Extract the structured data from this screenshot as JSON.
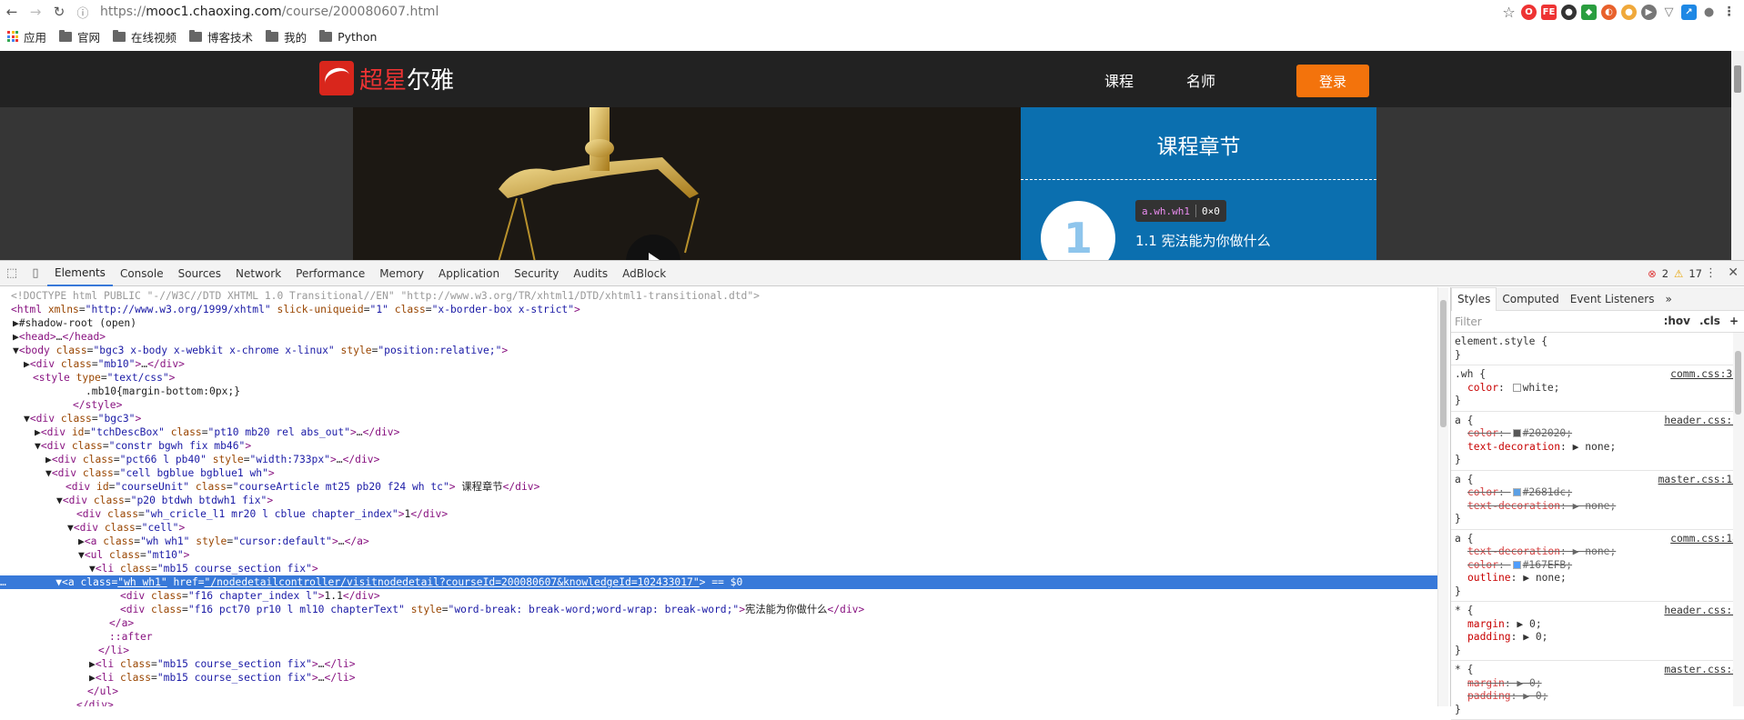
{
  "browser": {
    "url_prefix": "https://",
    "url_host": "mooc1.chaoxing.com",
    "url_path": "/course/200080607.html",
    "bookmarks": [
      "应用",
      "官网",
      "在线视频",
      "博客技术",
      "我的",
      "Python"
    ]
  },
  "site": {
    "logo_text_a": "超星",
    "logo_text_b": "尔雅",
    "nav": [
      "课程",
      "名师"
    ],
    "login": "登录",
    "panel_title": "课程章节",
    "chapter_num": "1",
    "chapter_label": "1.1  宪法能为你做什么",
    "tooltip_tag": "a.wh.wh1",
    "tooltip_size": "0×0"
  },
  "devtools": {
    "tabs": [
      "Elements",
      "Console",
      "Sources",
      "Network",
      "Performance",
      "Memory",
      "Application",
      "Security",
      "Audits",
      "AdBlock"
    ],
    "errors": "2",
    "warnings": "17",
    "side_tabs": [
      "Styles",
      "Computed",
      "Event Listeners",
      "»"
    ],
    "filter_placeholder": "Filter",
    "filter_hov": ":hov",
    "filter_cls": ".cls",
    "filter_add": "+"
  },
  "colors": {
    "accent": "#3879d9",
    "login": "#f3730c",
    "panel": "#0b6faf"
  }
}
